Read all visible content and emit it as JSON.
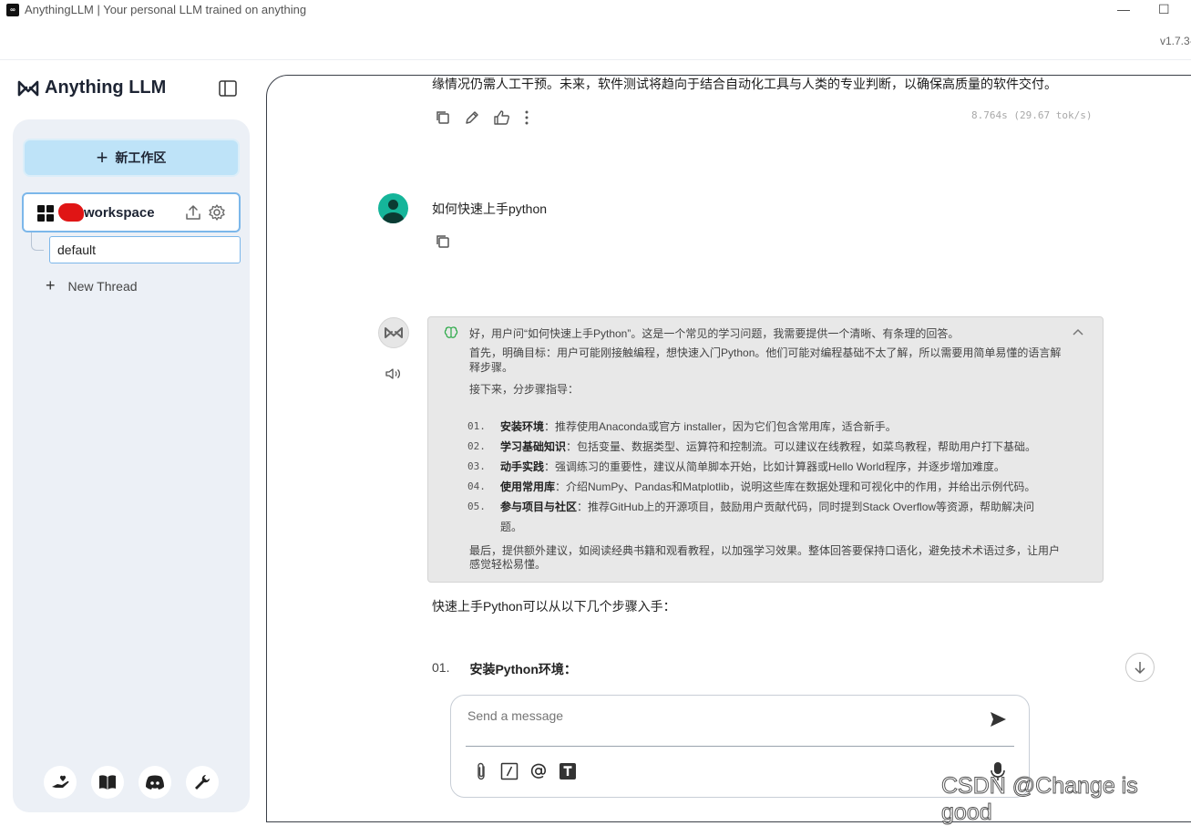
{
  "window": {
    "title": "AnythingLLM | Your personal LLM trained on anything",
    "app_icon_text": "∞",
    "minimize": "—",
    "maximize": "☐",
    "version": "v1.7.3-"
  },
  "sidebar": {
    "logo_text": "Anything LLM",
    "new_workspace_label": "新工作区",
    "workspace": {
      "name": "workspace"
    },
    "thread": {
      "name": "default"
    },
    "new_thread_label": "New Thread"
  },
  "chat": {
    "prev_response_tail": "缘情况仍需人工干预。未来，软件测试将趋向于结合自动化工具与人类的专业判断，以确保高质量的软件交付。",
    "timing": "8.764s (29.67 tok/s)",
    "user_message": "如何快速上手python",
    "thinking": {
      "intro": "好，用户问“如何快速上手Python”。这是一个常见的学习问题，我需要提供一个清晰、有条理的回答。",
      "p1": "首先，明确目标：用户可能刚接触编程，想快速入门Python。他们可能对编程基础不太了解，所以需要用简单易懂的语言解释步骤。",
      "p2": "接下来，分步骤指导：",
      "steps": [
        {
          "num": "01.",
          "bold": "安装环境",
          "text": "：推荐使用Anaconda或官方 installer，因为它们包含常用库，适合新手。"
        },
        {
          "num": "02.",
          "bold": "学习基础知识",
          "text": "：包括变量、数据类型、运算符和控制流。可以建议在线教程，如菜鸟教程，帮助用户打下基础。"
        },
        {
          "num": "03.",
          "bold": "动手实践",
          "text": "：强调练习的重要性，建议从简单脚本开始，比如计算器或Hello World程序，并逐步增加难度。"
        },
        {
          "num": "04.",
          "bold": "使用常用库",
          "text": "：介绍NumPy、Pandas和Matplotlib，说明这些库在数据处理和可视化中的作用，并给出示例代码。"
        },
        {
          "num": "05.",
          "bold": "参与项目与社区",
          "text": "：推荐GitHub上的开源项目，鼓励用户贡献代码，同时提到Stack Overflow等资源，帮助解决问题。"
        }
      ],
      "ending": "最后，提供额外建议，如阅读经典书籍和观看教程，以加强学习效果。整体回答要保持口语化，避免技术术语过多，让用户感觉轻松易懂。"
    },
    "answer_intro": "快速上手Python可以从以下几个步骤入手：",
    "answer_step": {
      "num": "01.",
      "label": "安装Python环境："
    }
  },
  "composer": {
    "placeholder": "Send a message"
  },
  "watermark": "CSDN @Change is good"
}
